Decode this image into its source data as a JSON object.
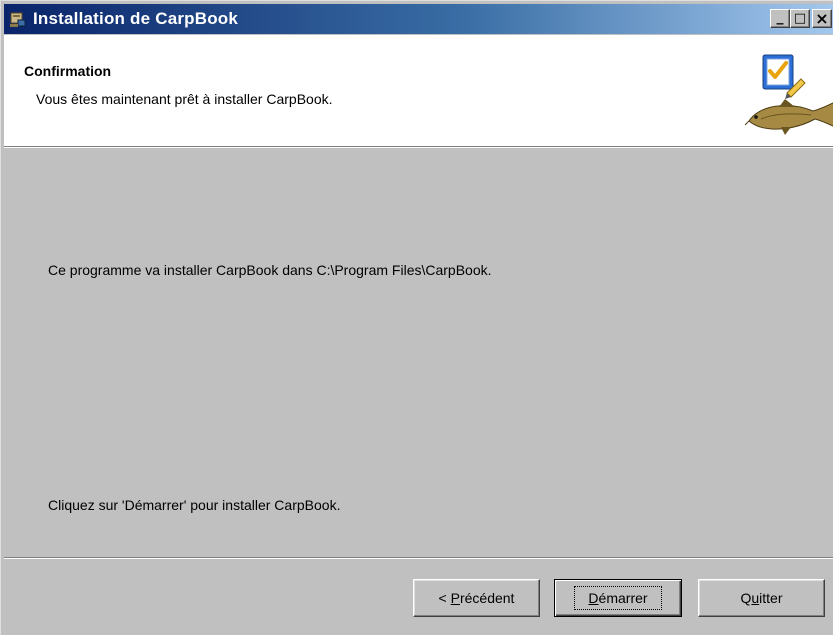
{
  "window": {
    "title": "Installation de CarpBook",
    "app_icon": "installer-icon",
    "controls": {
      "minimize": "_",
      "maximize": "□",
      "close": "×"
    }
  },
  "header": {
    "title": "Confirmation",
    "subtitle": "Vous êtes maintenant prêt à installer CarpBook.",
    "graphic": "checklist-carp-fish-graphic"
  },
  "body": {
    "line1": "Ce programme va installer CarpBook dans C:\\Program Files\\CarpBook.",
    "line2": "Cliquez sur 'Démarrer' pour installer CarpBook."
  },
  "buttons": {
    "previous": {
      "before": "< ",
      "accel": "P",
      "after": "récédent"
    },
    "start": {
      "before": "",
      "accel": "D",
      "after": "émarrer"
    },
    "quit": {
      "before": "Q",
      "accel": "u",
      "after": "itter"
    }
  },
  "colors": {
    "titlebar_start": "#0a246a",
    "titlebar_end": "#a6caf0",
    "face": "#c0c0c0"
  }
}
